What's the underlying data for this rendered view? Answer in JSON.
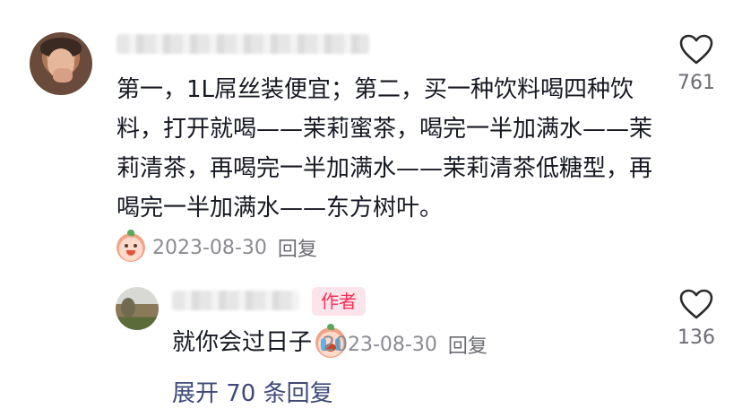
{
  "comment": {
    "text": "第一，1L屌丝装便宜；第二，买一种饮料喝四种饮料，打开就喝——茉莉蜜茶，喝完一半加满水——茉莉清茶，再喝完一半加满水——茉莉清茶低糖型，再喝完一半加满水——东方树叶。",
    "date": "2023-08-30",
    "reply_label": "回复",
    "like_count": "761",
    "emoji": "peach-smile-emoji"
  },
  "reply": {
    "author_badge": "作者",
    "text": "就你会过日子",
    "emoji": "peach-cry-emoji",
    "date": "2023-08-30",
    "reply_label": "回复",
    "like_count": "136"
  },
  "expand_label": "展开 70 条回复",
  "colors": {
    "text": "#161823",
    "meta": "#8a8b91",
    "author_badge_bg": "#fde4ea",
    "author_badge_text": "#fe2c55",
    "expand": "#3f4a7a"
  },
  "icons": {
    "like": "heart-outline-icon"
  }
}
